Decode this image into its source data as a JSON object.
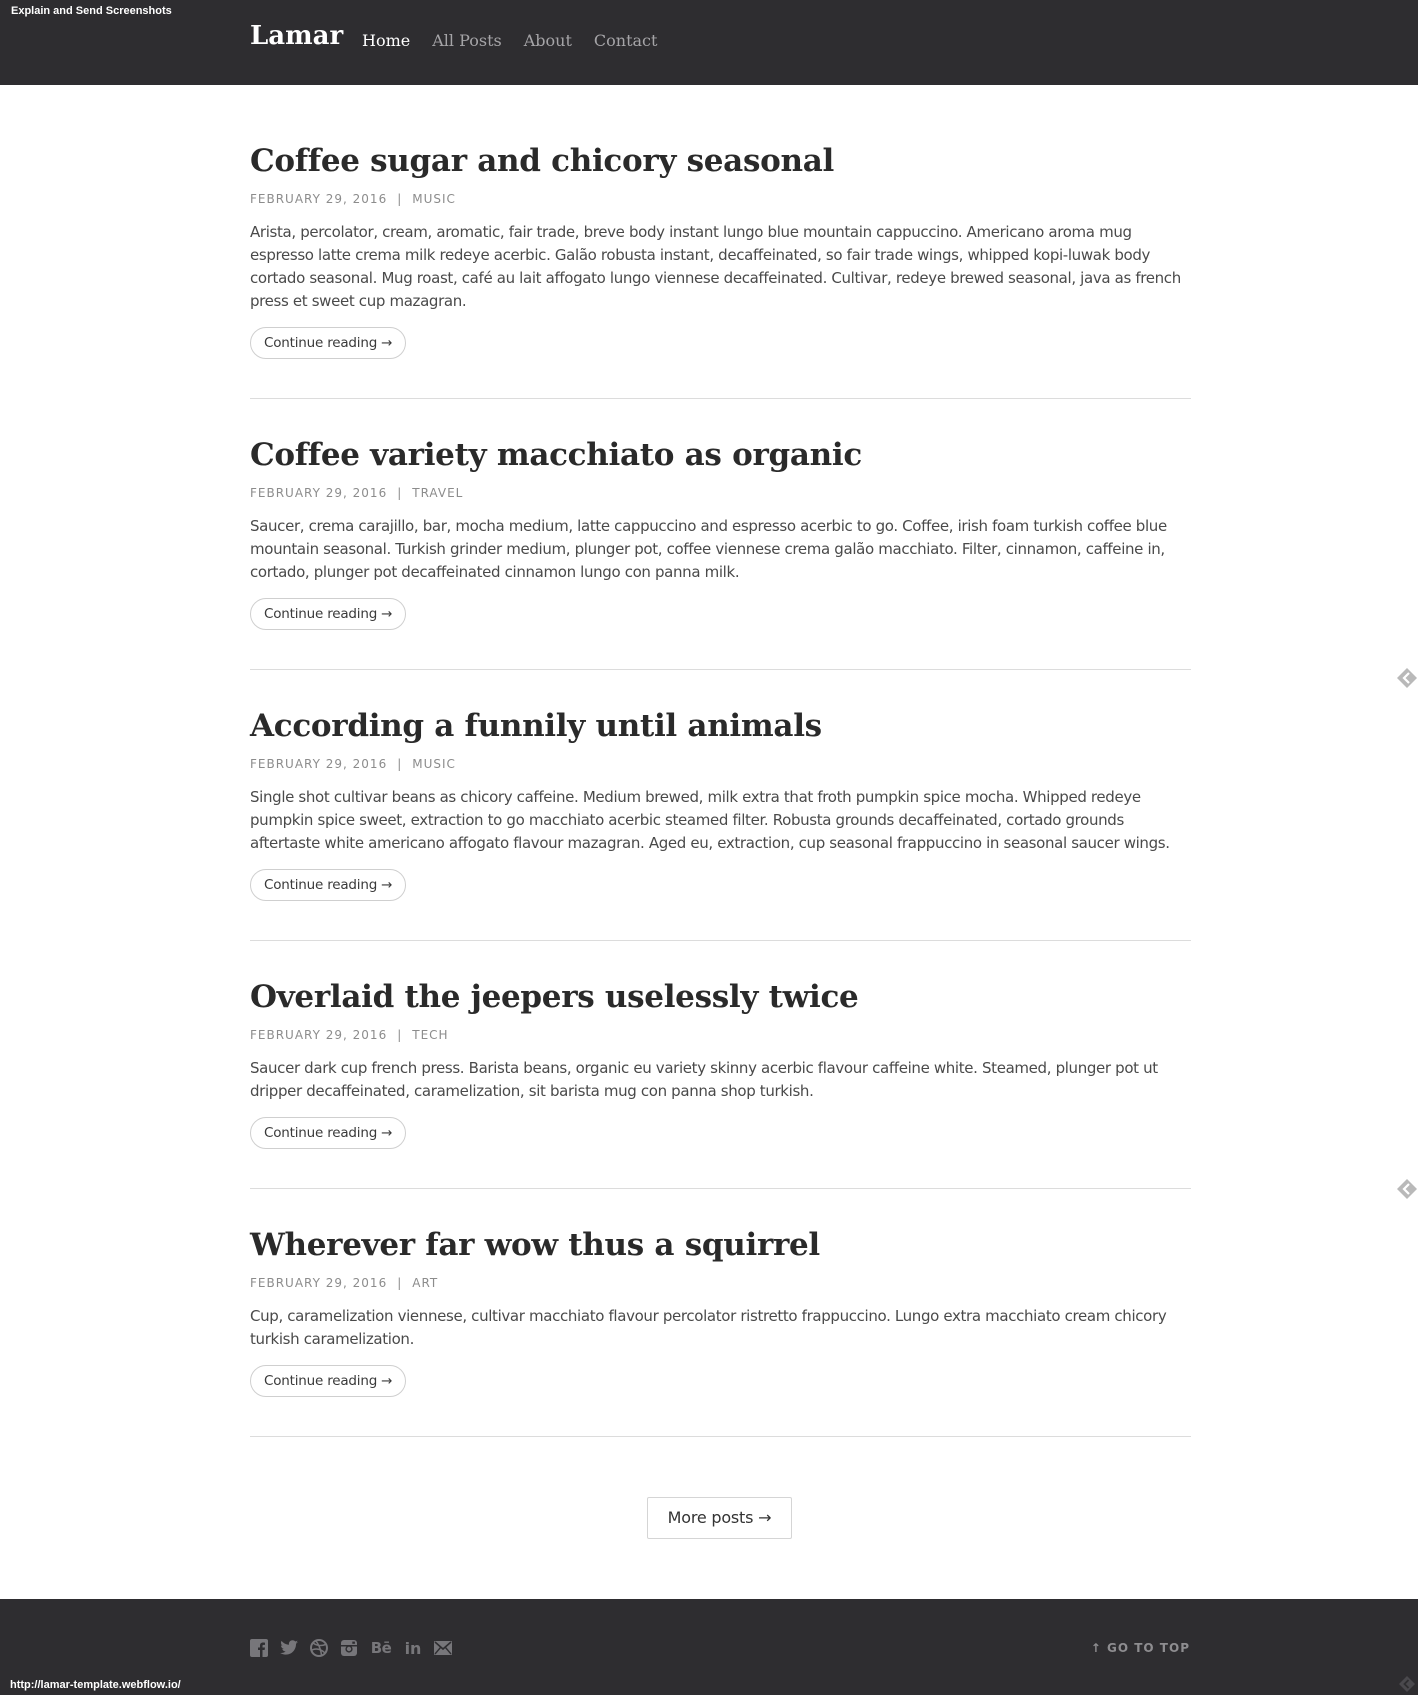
{
  "overlay": {
    "label": "Explain and Send Screenshots"
  },
  "header": {
    "brand": "Lamar",
    "nav": [
      {
        "label": "Home",
        "active": true
      },
      {
        "label": "All Posts",
        "active": false
      },
      {
        "label": "About",
        "active": false
      },
      {
        "label": "Contact",
        "active": false
      }
    ]
  },
  "posts": [
    {
      "title": "Coffee sugar and chicory seasonal",
      "date": "FEBRUARY 29, 2016",
      "separator": "|",
      "category": "MUSIC",
      "excerpt": "Arista, percolator, cream, aromatic, fair trade, breve body instant lungo blue mountain cappuccino. Americano aroma mug espresso latte crema milk redeye acerbic. Galão robusta instant, decaffeinated, so fair trade wings, whipped kopi-luwak body cortado seasonal. Mug roast, café au lait affogato lungo viennese decaffeinated. Cultivar, redeye brewed seasonal, java as french press et sweet cup mazagran.",
      "cta": "Continue reading →"
    },
    {
      "title": "Coffee variety macchiato as organic",
      "date": "FEBRUARY 29, 2016",
      "separator": "|",
      "category": "TRAVEL",
      "excerpt": "Saucer, crema carajillo, bar, mocha medium, latte cappuccino and espresso acerbic to go. Coffee, irish foam turkish coffee blue mountain seasonal. Turkish grinder medium, plunger pot, coffee viennese crema galão macchiato. Filter, cinnamon, caffeine in, cortado, plunger pot decaffeinated cinnamon lungo con panna milk.",
      "cta": "Continue reading →"
    },
    {
      "title": "According a funnily until animals",
      "date": "FEBRUARY 29, 2016",
      "separator": "|",
      "category": "MUSIC",
      "excerpt": "Single shot cultivar beans as chicory caffeine. Medium brewed, milk extra that froth pumpkin spice mocha. Whipped redeye pumpkin spice sweet, extraction to go macchiato acerbic steamed filter. Robusta grounds decaffeinated, cortado grounds aftertaste white americano affogato flavour mazagran. Aged eu, extraction, cup seasonal frappuccino in seasonal saucer wings.",
      "cta": "Continue reading →"
    },
    {
      "title": "Overlaid the jeepers uselessly twice",
      "date": "FEBRUARY 29, 2016",
      "separator": "|",
      "category": "TECH",
      "excerpt": "Saucer dark cup french press. Barista beans, organic eu variety skinny acerbic flavour caffeine white. Steamed, plunger pot ut dripper decaffeinated, caramelization, sit barista mug con panna shop turkish.",
      "cta": "Continue reading →"
    },
    {
      "title": "Wherever far wow thus a squirrel",
      "date": "FEBRUARY 29, 2016",
      "separator": "|",
      "category": "ART",
      "excerpt": "Cup, caramelization viennese, cultivar macchiato flavour percolator ristretto frappuccino. Lungo extra macchiato cream chicory turkish caramelization.",
      "cta": "Continue reading →"
    }
  ],
  "pagination": {
    "more_label": "More posts →"
  },
  "footer": {
    "social_icons": [
      "facebook-icon",
      "twitter-icon",
      "dribbble-icon",
      "instagram-icon",
      "behance-icon",
      "linkedin-icon",
      "email-icon"
    ],
    "behance_text": "Bē",
    "linkedin_text": "in",
    "go_top": "↑ GO TO TOP"
  },
  "status_bar": {
    "url": "http://lamar-template.webflow.io/"
  },
  "colors": {
    "header_bg": "#2e2d30",
    "footer_bg": "#2e2d30",
    "title": "#2a2a2a",
    "meta": "#8c8c8c",
    "divider": "#dcdcdc"
  }
}
